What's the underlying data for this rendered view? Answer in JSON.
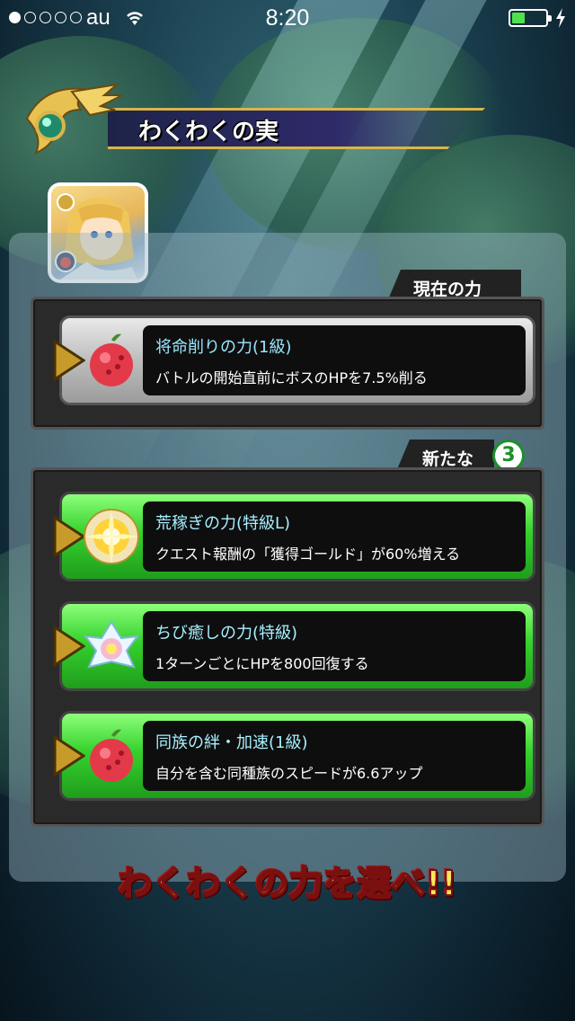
{
  "status_bar": {
    "carrier": "au",
    "time": "8:20",
    "signal_filled": 1,
    "signal_total": 5,
    "battery_level": 0.3,
    "battery_color": "#4ee24c"
  },
  "header": {
    "title": "わくわくの実"
  },
  "current_power": {
    "tag_label": "現在の力",
    "item": {
      "name": "将命削りの力(1級)",
      "description": "バトルの開始直前にボスのHPを7.5%削る",
      "icon": "red-fruit-icon"
    }
  },
  "new_fruits": {
    "tag_label": "新たな実",
    "count": "3",
    "items": [
      {
        "name": "荒稼ぎの力(特級L)",
        "description": "クエスト報酬の「獲得ゴールド」が60%増える",
        "icon": "golden-burst-fruit-icon"
      },
      {
        "name": "ちび癒しの力(特級)",
        "description": "1ターンごとにHPを800回復する",
        "icon": "white-lotus-fruit-icon"
      },
      {
        "name": "同族の絆・加速(1級)",
        "description": "自分を含む同種族のスピードが6.6アップ",
        "icon": "red-fruit-icon"
      }
    ]
  },
  "footer": {
    "prompt": "わくわくの力を選べ!!"
  },
  "colors": {
    "accent_gold": "#d9b54a",
    "slot_green": "#35d12d",
    "slot_gray": "#bdbdbd",
    "name_text": "#9ae6ff"
  }
}
